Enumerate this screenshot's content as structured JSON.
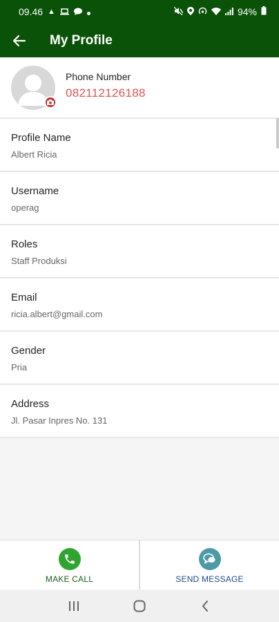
{
  "status_bar": {
    "time": "09.46",
    "battery": "94%",
    "left_icons": [
      "navigation-icon",
      "laptop-icon",
      "chat-icon",
      "dot-icon"
    ],
    "right_icons": [
      "mute-icon",
      "location-icon",
      "hotspot-icon",
      "wifi-icon",
      "signal-icon",
      "battery-icon"
    ]
  },
  "header": {
    "title": "My Profile"
  },
  "profile": {
    "phone_label": "Phone Number",
    "phone_value": "082112126188"
  },
  "fields": [
    {
      "label": "Profile Name",
      "value": "Albert Ricia"
    },
    {
      "label": "Username",
      "value": "operag"
    },
    {
      "label": "Roles",
      "value": "Staff Produksi"
    },
    {
      "label": "Email",
      "value": "ricia.albert@gmail.com"
    },
    {
      "label": "Gender",
      "value": "Pria"
    },
    {
      "label": "Address",
      "value": "Jl. Pasar Inpres No. 131"
    }
  ],
  "actions": {
    "call_label": "MAKE CALL",
    "message_label": "SEND MESSAGE"
  },
  "colors": {
    "appbar": "#0a5208",
    "phone_value": "#e05252",
    "call_icon_bg": "#2fa52f",
    "message_icon_bg": "#4d9aa7"
  }
}
